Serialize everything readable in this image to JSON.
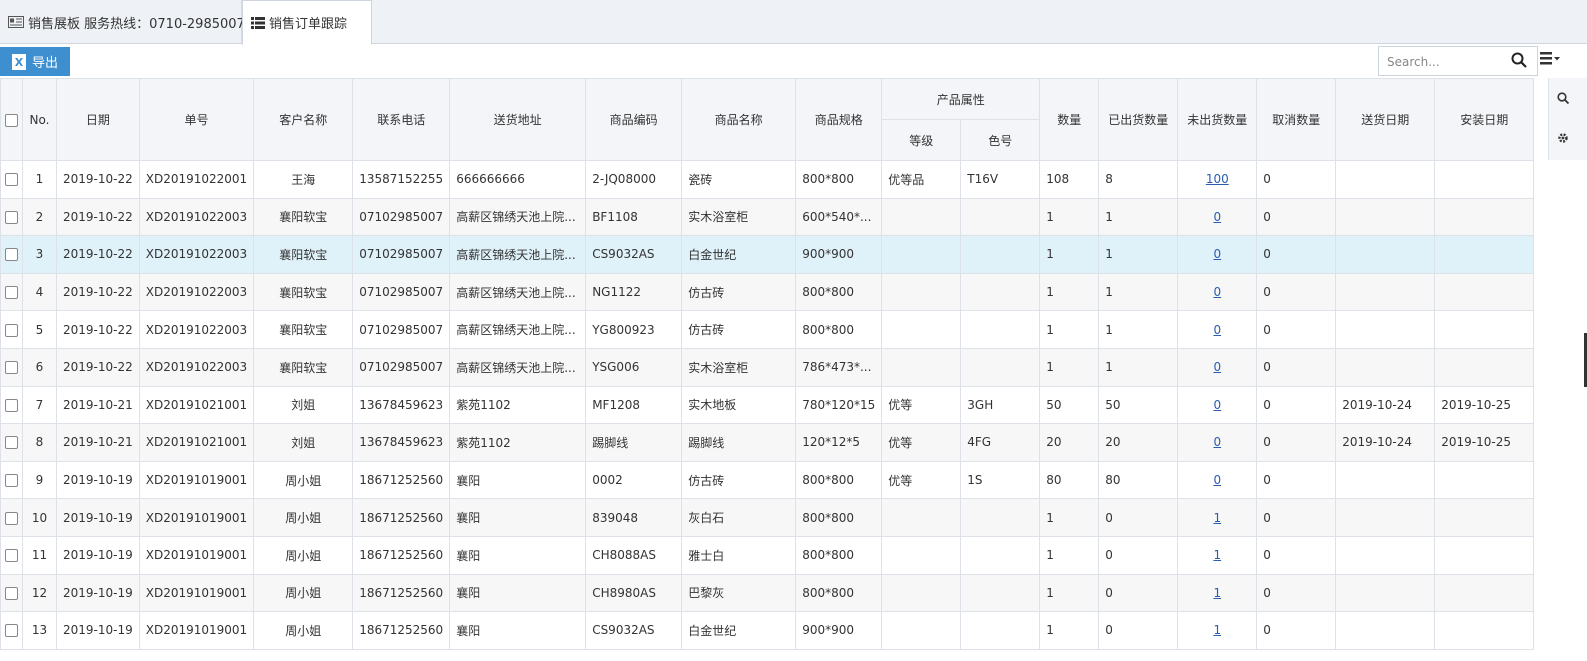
{
  "tabs": [
    {
      "label": "销售展板 服务热线：0710-2985007",
      "icon": "dashboard-icon"
    },
    {
      "label": "销售订单跟踪",
      "icon": "list-icon"
    }
  ],
  "toolbar": {
    "export_label": "导出",
    "search_placeholder": "Search..."
  },
  "table": {
    "headers": {
      "no": "No.",
      "date": "日期",
      "order_no": "单号",
      "customer": "客户名称",
      "phone": "联系电话",
      "address": "送货地址",
      "product_code": "商品编码",
      "product_name": "商品名称",
      "spec": "商品规格",
      "attrs": "产品属性",
      "grade": "等级",
      "color_no": "色号",
      "qty": "数量",
      "shipped": "已出货数量",
      "unshipped": "未出货数量",
      "cancelled": "取消数量",
      "delivery_date": "送货日期",
      "install_date": "安装日期"
    },
    "rows": [
      {
        "no": "1",
        "date": "2019-10-22",
        "order_no": "XD20191022001",
        "customer": "王海",
        "phone": "13587152255",
        "address": "666666666",
        "product_code": "2-JQ08000",
        "product_name": "瓷砖",
        "spec": "800*800",
        "grade": "优等品",
        "color_no": "T16V",
        "qty": "108",
        "shipped": "8",
        "unshipped": "100",
        "cancelled": "0",
        "delivery_date": "",
        "install_date": ""
      },
      {
        "no": "2",
        "date": "2019-10-22",
        "order_no": "XD20191022003",
        "customer": "襄阳软宝",
        "phone": "07102985007",
        "address": "高薪区锦绣天池上院...",
        "product_code": "BF1108",
        "product_name": "实木浴室柜",
        "spec": "600*540*...",
        "grade": "",
        "color_no": "",
        "qty": "1",
        "shipped": "1",
        "unshipped": "0",
        "cancelled": "0",
        "delivery_date": "",
        "install_date": ""
      },
      {
        "no": "3",
        "date": "2019-10-22",
        "order_no": "XD20191022003",
        "customer": "襄阳软宝",
        "phone": "07102985007",
        "address": "高薪区锦绣天池上院...",
        "product_code": "CS9032AS",
        "product_name": "白金世纪",
        "spec": "900*900",
        "grade": "",
        "color_no": "",
        "qty": "1",
        "shipped": "1",
        "unshipped": "0",
        "cancelled": "0",
        "delivery_date": "",
        "install_date": ""
      },
      {
        "no": "4",
        "date": "2019-10-22",
        "order_no": "XD20191022003",
        "customer": "襄阳软宝",
        "phone": "07102985007",
        "address": "高薪区锦绣天池上院...",
        "product_code": "NG1122",
        "product_name": "仿古砖",
        "spec": "800*800",
        "grade": "",
        "color_no": "",
        "qty": "1",
        "shipped": "1",
        "unshipped": "0",
        "cancelled": "0",
        "delivery_date": "",
        "install_date": ""
      },
      {
        "no": "5",
        "date": "2019-10-22",
        "order_no": "XD20191022003",
        "customer": "襄阳软宝",
        "phone": "07102985007",
        "address": "高薪区锦绣天池上院...",
        "product_code": "YG800923",
        "product_name": "仿古砖",
        "spec": "800*800",
        "grade": "",
        "color_no": "",
        "qty": "1",
        "shipped": "1",
        "unshipped": "0",
        "cancelled": "0",
        "delivery_date": "",
        "install_date": ""
      },
      {
        "no": "6",
        "date": "2019-10-22",
        "order_no": "XD20191022003",
        "customer": "襄阳软宝",
        "phone": "07102985007",
        "address": "高薪区锦绣天池上院...",
        "product_code": "YSG006",
        "product_name": "实木浴室柜",
        "spec": "786*473*...",
        "grade": "",
        "color_no": "",
        "qty": "1",
        "shipped": "1",
        "unshipped": "0",
        "cancelled": "0",
        "delivery_date": "",
        "install_date": ""
      },
      {
        "no": "7",
        "date": "2019-10-21",
        "order_no": "XD20191021001",
        "customer": "刘姐",
        "phone": "13678459623",
        "address": "紫苑1102",
        "product_code": "MF1208",
        "product_name": "实木地板",
        "spec": "780*120*15",
        "grade": "优等",
        "color_no": "3GH",
        "qty": "50",
        "shipped": "50",
        "unshipped": "0",
        "cancelled": "0",
        "delivery_date": "2019-10-24",
        "install_date": "2019-10-25"
      },
      {
        "no": "8",
        "date": "2019-10-21",
        "order_no": "XD20191021001",
        "customer": "刘姐",
        "phone": "13678459623",
        "address": "紫苑1102",
        "product_code": "踢脚线",
        "product_name": "踢脚线",
        "spec": "120*12*5",
        "grade": "优等",
        "color_no": "4FG",
        "qty": "20",
        "shipped": "20",
        "unshipped": "0",
        "cancelled": "0",
        "delivery_date": "2019-10-24",
        "install_date": "2019-10-25"
      },
      {
        "no": "9",
        "date": "2019-10-19",
        "order_no": "XD20191019001",
        "customer": "周小姐",
        "phone": "18671252560",
        "address": "襄阳",
        "product_code": "0002",
        "product_name": "仿古砖",
        "spec": "800*800",
        "grade": "优等",
        "color_no": "1S",
        "qty": "80",
        "shipped": "80",
        "unshipped": "0",
        "cancelled": "0",
        "delivery_date": "",
        "install_date": ""
      },
      {
        "no": "10",
        "date": "2019-10-19",
        "order_no": "XD20191019001",
        "customer": "周小姐",
        "phone": "18671252560",
        "address": "襄阳",
        "product_code": "839048",
        "product_name": "灰白石",
        "spec": "800*800",
        "grade": "",
        "color_no": "",
        "qty": "1",
        "shipped": "0",
        "unshipped": "1",
        "cancelled": "0",
        "delivery_date": "",
        "install_date": ""
      },
      {
        "no": "11",
        "date": "2019-10-19",
        "order_no": "XD20191019001",
        "customer": "周小姐",
        "phone": "18671252560",
        "address": "襄阳",
        "product_code": "CH8088AS",
        "product_name": "雅士白",
        "spec": "800*800",
        "grade": "",
        "color_no": "",
        "qty": "1",
        "shipped": "0",
        "unshipped": "1",
        "cancelled": "0",
        "delivery_date": "",
        "install_date": ""
      },
      {
        "no": "12",
        "date": "2019-10-19",
        "order_no": "XD20191019001",
        "customer": "周小姐",
        "phone": "18671252560",
        "address": "襄阳",
        "product_code": "CH8980AS",
        "product_name": "巴黎灰",
        "spec": "800*800",
        "grade": "",
        "color_no": "",
        "qty": "1",
        "shipped": "0",
        "unshipped": "1",
        "cancelled": "0",
        "delivery_date": "",
        "install_date": ""
      },
      {
        "no": "13",
        "date": "2019-10-19",
        "order_no": "XD20191019001",
        "customer": "周小姐",
        "phone": "18671252560",
        "address": "襄阳",
        "product_code": "CS9032AS",
        "product_name": "白金世纪",
        "spec": "900*900",
        "grade": "",
        "color_no": "",
        "qty": "1",
        "shipped": "0",
        "unshipped": "1",
        "cancelled": "0",
        "delivery_date": "",
        "install_date": ""
      }
    ],
    "selected_row": 3
  },
  "colors": {
    "accent": "#3e8fd0",
    "selected_row": "#dff1f9",
    "link": "#2a5db0"
  }
}
